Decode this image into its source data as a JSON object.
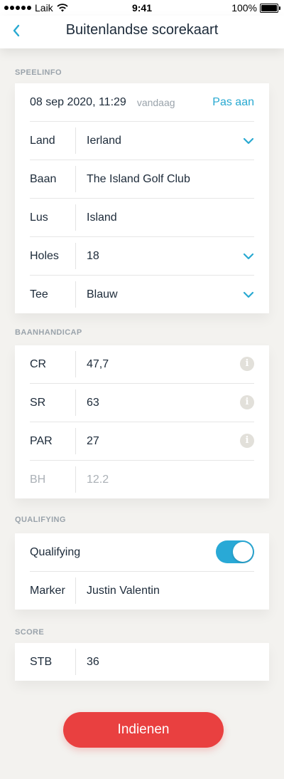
{
  "status_bar": {
    "carrier": "Laik",
    "time": "9:41",
    "battery": "100%"
  },
  "header": {
    "title": "Buitenlandse scorekaart"
  },
  "speelinfo": {
    "label": "SPEELINFO",
    "date": "08 sep 2020, 11:29",
    "today": "vandaag",
    "edit": "Pas aan",
    "rows": [
      {
        "label": "Land",
        "value": "Ierland"
      },
      {
        "label": "Baan",
        "value": "The Island Golf Club"
      },
      {
        "label": "Lus",
        "value": "Island"
      },
      {
        "label": "Holes",
        "value": "18"
      },
      {
        "label": "Tee",
        "value": "Blauw"
      }
    ]
  },
  "baanhandicap": {
    "label": "BAANHANDICAP",
    "rows": [
      {
        "label": "CR",
        "value": "47,7"
      },
      {
        "label": "SR",
        "value": "63"
      },
      {
        "label": "PAR",
        "value": "27"
      },
      {
        "label": "BH",
        "value": "12.2"
      }
    ]
  },
  "qualifying": {
    "label": "QUALIFYING",
    "toggle_label": "Qualifying",
    "toggle_on": true,
    "marker_label": "Marker",
    "marker_value": "Justin Valentin"
  },
  "score": {
    "label": "SCORE",
    "rows": [
      {
        "label": "STB",
        "value": "36"
      }
    ]
  },
  "submit_label": "Indienen",
  "colors": {
    "accent": "#28a9d1",
    "submit": "#e94040",
    "background": "#f3f2ef"
  }
}
